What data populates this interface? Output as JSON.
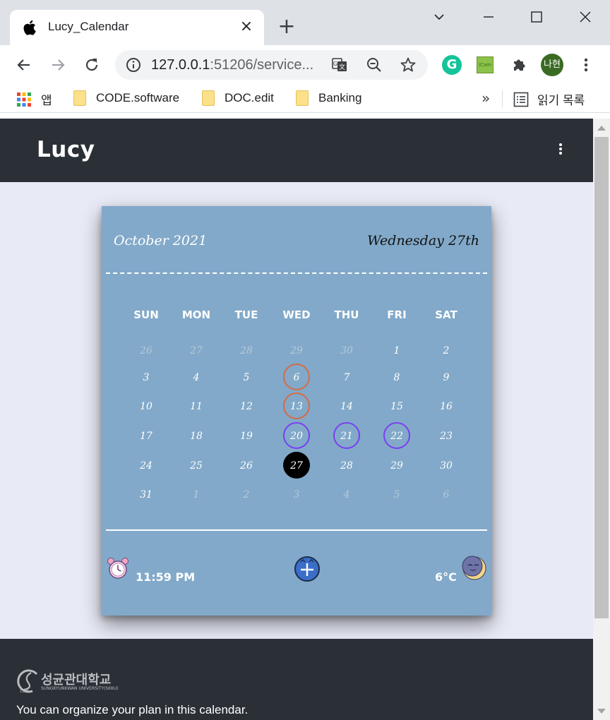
{
  "browser": {
    "tab_title": "Lucy_Calendar",
    "tab_close": "×",
    "new_tab": "+",
    "url_host": "127.0.0.1",
    "url_rest": ":51206/service...",
    "avatar_text": "나현",
    "ext_g": "G",
    "ext_icam": "iCam",
    "bookmarks": [
      {
        "label": "앱",
        "icon": "apps-grid-icon"
      },
      {
        "label": "CODE.software",
        "icon": "folder-icon"
      },
      {
        "label": "DOC.edit",
        "icon": "folder-icon"
      },
      {
        "label": "Banking",
        "icon": "folder-icon"
      }
    ],
    "bookmarks_more": "»",
    "reading_list": "읽기 목록"
  },
  "app": {
    "title": "Lucy"
  },
  "calendar": {
    "month_label": "October 2021",
    "today_label": "Wednesday 27th",
    "weekdays": [
      "SUN",
      "MON",
      "TUE",
      "WED",
      "THU",
      "FRI",
      "SAT"
    ],
    "weeks": [
      [
        {
          "d": "26",
          "muted": true
        },
        {
          "d": "27",
          "muted": true
        },
        {
          "d": "28",
          "muted": true
        },
        {
          "d": "29",
          "muted": true
        },
        {
          "d": "30",
          "muted": true
        },
        {
          "d": "1"
        },
        {
          "d": "2"
        }
      ],
      [
        {
          "d": "3"
        },
        {
          "d": "4"
        },
        {
          "d": "5"
        },
        {
          "d": "6",
          "mark": "red"
        },
        {
          "d": "7"
        },
        {
          "d": "8"
        },
        {
          "d": "9"
        }
      ],
      [
        {
          "d": "10"
        },
        {
          "d": "11"
        },
        {
          "d": "12"
        },
        {
          "d": "13",
          "mark": "red"
        },
        {
          "d": "14"
        },
        {
          "d": "15"
        },
        {
          "d": "16"
        }
      ],
      [
        {
          "d": "17"
        },
        {
          "d": "18"
        },
        {
          "d": "19"
        },
        {
          "d": "20",
          "mark": "purple"
        },
        {
          "d": "21",
          "mark": "purple"
        },
        {
          "d": "22",
          "mark": "purple"
        },
        {
          "d": "23"
        }
      ],
      [
        {
          "d": "24"
        },
        {
          "d": "25"
        },
        {
          "d": "26"
        },
        {
          "d": "27",
          "mark": "today"
        },
        {
          "d": "28"
        },
        {
          "d": "29"
        },
        {
          "d": "30"
        }
      ],
      [
        {
          "d": "31"
        },
        {
          "d": "1",
          "muted": true
        },
        {
          "d": "2",
          "muted": true
        },
        {
          "d": "3",
          "muted": true
        },
        {
          "d": "4",
          "muted": true
        },
        {
          "d": "5",
          "muted": true
        },
        {
          "d": "6",
          "muted": true
        }
      ]
    ],
    "time": "11:59 PM",
    "temperature": "6°C",
    "colors": {
      "background": "#82a9c9",
      "ring_red": "#d56b47",
      "ring_purple": "#7b3ff2",
      "today_fill": "#000000"
    }
  },
  "footer": {
    "logo_text": "성균관대학교",
    "logo_sub": "SUNGKYUNKWAN UNIVERSITY(SKKU)",
    "description": "You can organize your plan in this calendar."
  }
}
